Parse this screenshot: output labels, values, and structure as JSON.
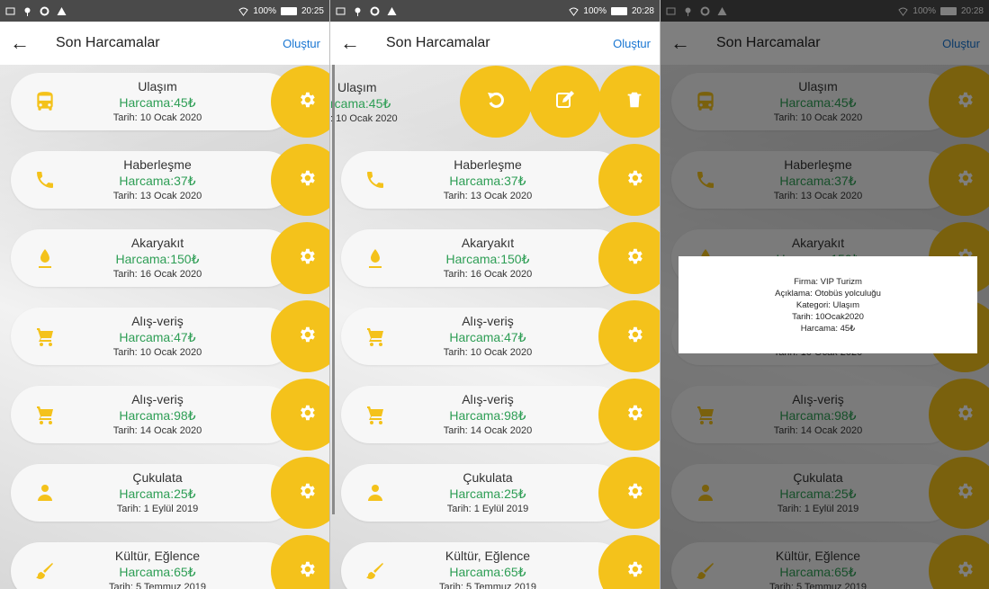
{
  "status_times": [
    "20:25",
    "20:28",
    "20:28"
  ],
  "battery_text": "100%",
  "title": "Son Harcamalar",
  "create_label": "Oluştur",
  "back_icon": "arrow-left-icon",
  "colors": {
    "accent": "#f4c21b",
    "amount": "#2e9e55",
    "link": "#1976d2"
  },
  "items": [
    {
      "name": "Ulaşım",
      "amount": "Harcama:45₺",
      "date": "Tarih: 10 Ocak 2020",
      "icon": "bus-icon"
    },
    {
      "name": "Haberleşme",
      "amount": "Harcama:37₺",
      "date": "Tarih: 13 Ocak 2020",
      "icon": "phone-icon"
    },
    {
      "name": "Akaryakıt",
      "amount": "Harcama:150₺",
      "date": "Tarih: 16 Ocak 2020",
      "icon": "fuel-icon"
    },
    {
      "name": "Alış-veriş",
      "amount": "Harcama:47₺",
      "date": "Tarih: 10 Ocak 2020",
      "icon": "cart-icon"
    },
    {
      "name": "Alış-veriş",
      "amount": "Harcama:98₺",
      "date": "Tarih: 14 Ocak 2020",
      "icon": "cart-icon"
    },
    {
      "name": "Çukulata",
      "amount": "Harcama:25₺",
      "date": "Tarih: 1 Eylül 2019",
      "icon": "person-icon"
    },
    {
      "name": "Kültür, Eğlence",
      "amount": "Harcama:65₺",
      "date": "Tarih: 5 Temmuz 2019",
      "icon": "brush-icon"
    }
  ],
  "swiped_item": {
    "name": "Ulaşım",
    "amount": "rcama:45₺",
    "date": ": 10 Ocak 2020"
  },
  "dialog": {
    "firm": "Firma: VIP Turizm",
    "desc": "Açıklama: Otobüs yolculuğu",
    "cat": "Kategori: Ulaşım",
    "date": "Tarih: 10Ocak2020",
    "amount": "Harcama: 45₺"
  }
}
